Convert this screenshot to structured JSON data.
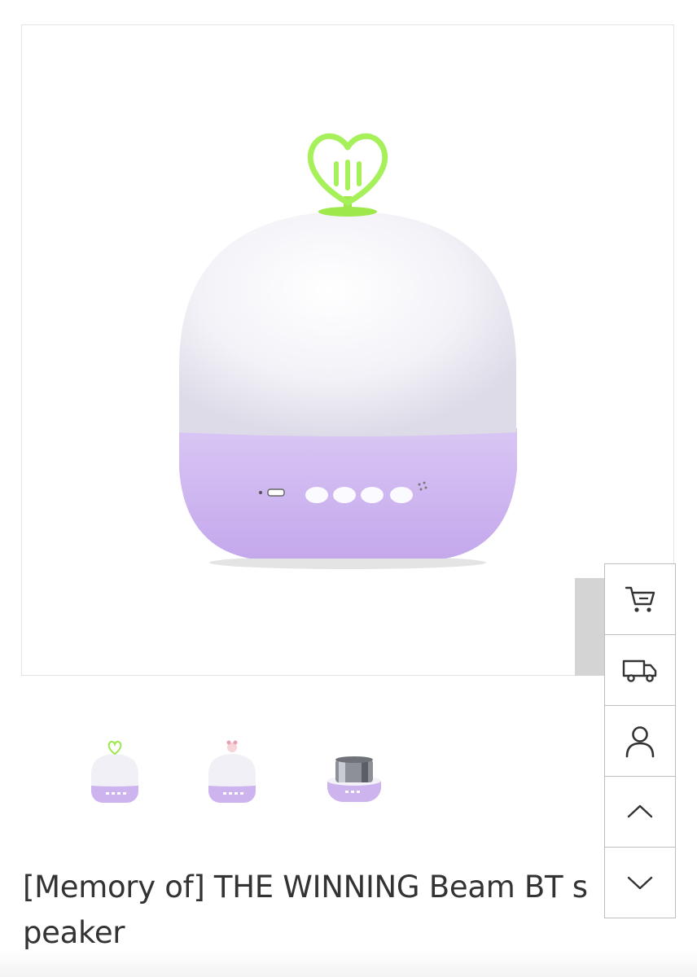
{
  "product": {
    "title": "[Memory of] THE WINNING Beam BT speaker",
    "main_image": {
      "alt": "THE WINNING Beam BT speaker",
      "colors": {
        "dome": "#f2f1f8",
        "base": "#cdb4ee",
        "accent": "#9df04a"
      }
    }
  },
  "thumbnails": [
    {
      "variant": "green-heart-topper"
    },
    {
      "variant": "pink-character-topper"
    },
    {
      "variant": "silver-speaker-insert"
    }
  ],
  "side_toolbar": [
    {
      "name": "cart",
      "icon": "cart-icon"
    },
    {
      "name": "delivery",
      "icon": "truck-icon"
    },
    {
      "name": "my-page",
      "icon": "user-icon"
    },
    {
      "name": "scroll-top",
      "icon": "chevron-up-icon"
    },
    {
      "name": "scroll-bottom",
      "icon": "chevron-down-icon"
    }
  ],
  "colors": {
    "border": "#bdbdbd",
    "frame_border": "#e3e3e3",
    "text": "#333333"
  }
}
